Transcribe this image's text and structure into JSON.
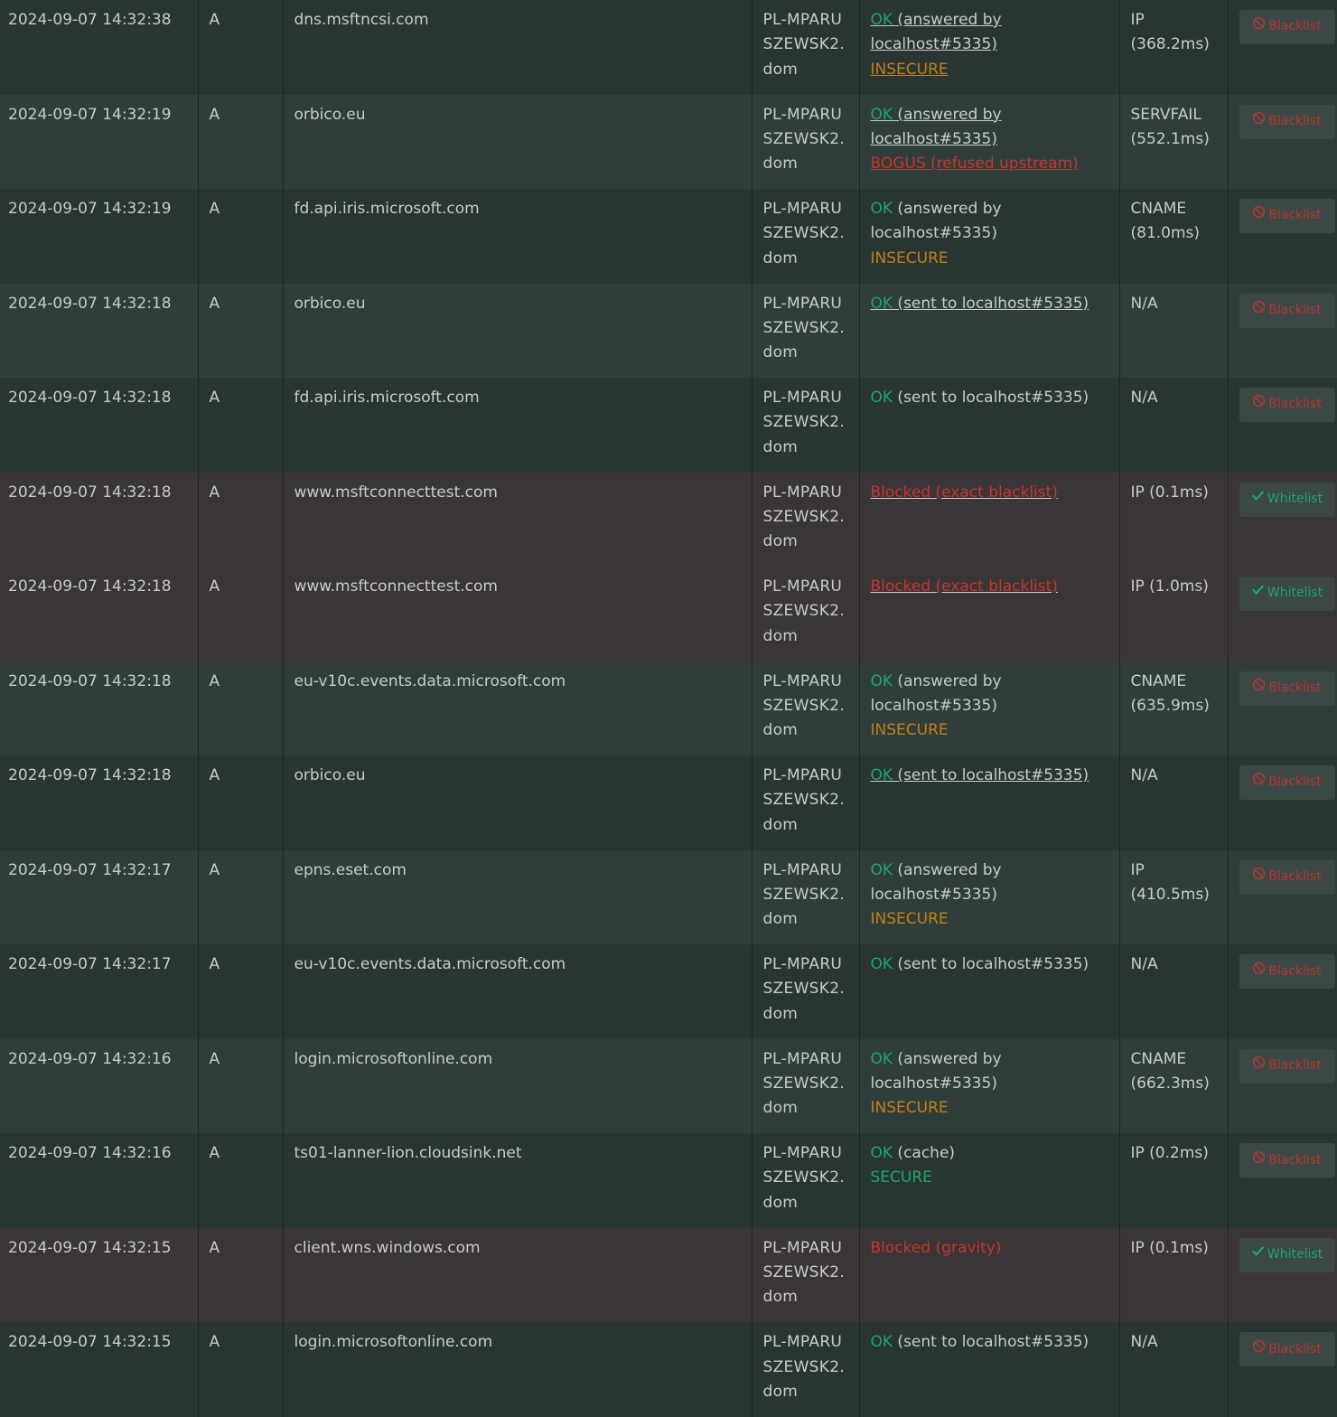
{
  "rows": [
    {
      "time": "2024-09-07 14:32:38",
      "type": "A",
      "domain": "dns.msftncsi.com",
      "client": "PL-MPARUSZEWSK2.dom",
      "status": "OK",
      "status_detail": " (answered by localhost#5335)",
      "status_class": "ok",
      "underline": true,
      "dnssec": "INSECURE",
      "dnssec_class": "insecure",
      "dnssec_underline": true,
      "reply": "IP (368.2ms)",
      "action": "Blacklist",
      "action_kind": "blacklist",
      "action_icon": "ban-icon"
    },
    {
      "time": "2024-09-07 14:32:19",
      "type": "A",
      "domain": "orbico.eu",
      "client": "PL-MPARUSZEWSK2.dom",
      "status": "OK",
      "status_detail": " (answered by localhost#5335)",
      "status_class": "ok",
      "underline": true,
      "dnssec": "BOGUS (refused upstream)",
      "dnssec_class": "red",
      "dnssec_underline": true,
      "reply": "SERVFAIL (552.1ms)",
      "action": "Blacklist",
      "action_kind": "blacklist",
      "action_icon": "ban-icon"
    },
    {
      "time": "2024-09-07 14:32:19",
      "type": "A",
      "domain": "fd.api.iris.microsoft.com",
      "client": "PL-MPARUSZEWSK2.dom",
      "status": "OK",
      "status_detail": " (answered by localhost#5335)",
      "status_class": "ok",
      "underline": false,
      "dnssec": "INSECURE",
      "dnssec_class": "insecure",
      "dnssec_underline": false,
      "reply": "CNAME (81.0ms)",
      "action": "Blacklist",
      "action_kind": "blacklist",
      "action_icon": "ban-icon"
    },
    {
      "time": "2024-09-07 14:32:18",
      "type": "A",
      "domain": "orbico.eu",
      "client": "PL-MPARUSZEWSK2.dom",
      "status": "OK",
      "status_detail": " (sent to localhost#5335)",
      "status_class": "ok",
      "underline": true,
      "dnssec": "",
      "dnssec_class": "",
      "dnssec_underline": false,
      "reply": "N/A",
      "action": "Blacklist",
      "action_kind": "blacklist",
      "action_icon": "ban-icon"
    },
    {
      "time": "2024-09-07 14:32:18",
      "type": "A",
      "domain": "fd.api.iris.microsoft.com",
      "client": "PL-MPARUSZEWSK2.dom",
      "status": "OK",
      "status_detail": " (sent to localhost#5335)",
      "status_class": "ok",
      "underline": false,
      "dnssec": "",
      "dnssec_class": "",
      "dnssec_underline": false,
      "reply": "N/A",
      "action": "Blacklist",
      "action_kind": "blacklist",
      "action_icon": "ban-icon"
    },
    {
      "time": "2024-09-07 14:32:18",
      "type": "A",
      "domain": "www.msftconnecttest.com",
      "client": "PL-MPARUSZEWSK2.dom",
      "status": "Blocked (exact blacklist)",
      "status_detail": "",
      "status_class": "red",
      "underline": true,
      "dnssec": "",
      "dnssec_class": "",
      "dnssec_underline": false,
      "reply": "IP (0.1ms)",
      "action": "Whitelist",
      "action_kind": "whitelist",
      "action_icon": "check-icon",
      "blocked": true
    },
    {
      "time": "2024-09-07 14:32:18",
      "type": "A",
      "domain": "www.msftconnecttest.com",
      "client": "PL-MPARUSZEWSK2.dom",
      "status": "Blocked (exact blacklist)",
      "status_detail": "",
      "status_class": "red",
      "underline": true,
      "dnssec": "",
      "dnssec_class": "",
      "dnssec_underline": false,
      "reply": "IP (1.0ms)",
      "action": "Whitelist",
      "action_kind": "whitelist",
      "action_icon": "check-icon",
      "blocked": true
    },
    {
      "time": "2024-09-07 14:32:18",
      "type": "A",
      "domain": "eu-v10c.events.data.microsoft.com",
      "client": "PL-MPARUSZEWSK2.dom",
      "status": "OK",
      "status_detail": " (answered by localhost#5335)",
      "status_class": "ok",
      "underline": false,
      "dnssec": "INSECURE",
      "dnssec_class": "insecure",
      "dnssec_underline": false,
      "reply": "CNAME (635.9ms)",
      "action": "Blacklist",
      "action_kind": "blacklist",
      "action_icon": "ban-icon"
    },
    {
      "time": "2024-09-07 14:32:18",
      "type": "A",
      "domain": "orbico.eu",
      "client": "PL-MPARUSZEWSK2.dom",
      "status": "OK",
      "status_detail": " (sent to localhost#5335)",
      "status_class": "ok",
      "underline": true,
      "dnssec": "",
      "dnssec_class": "",
      "dnssec_underline": false,
      "reply": "N/A",
      "action": "Blacklist",
      "action_kind": "blacklist",
      "action_icon": "ban-icon"
    },
    {
      "time": "2024-09-07 14:32:17",
      "type": "A",
      "domain": "epns.eset.com",
      "client": "PL-MPARUSZEWSK2.dom",
      "status": "OK",
      "status_detail": " (answered by localhost#5335)",
      "status_class": "ok",
      "underline": false,
      "dnssec": "INSECURE",
      "dnssec_class": "insecure",
      "dnssec_underline": false,
      "reply": "IP (410.5ms)",
      "action": "Blacklist",
      "action_kind": "blacklist",
      "action_icon": "ban-icon"
    },
    {
      "time": "2024-09-07 14:32:17",
      "type": "A",
      "domain": "eu-v10c.events.data.microsoft.com",
      "client": "PL-MPARUSZEWSK2.dom",
      "status": "OK",
      "status_detail": " (sent to localhost#5335)",
      "status_class": "ok",
      "underline": false,
      "dnssec": "",
      "dnssec_class": "",
      "dnssec_underline": false,
      "reply": "N/A",
      "action": "Blacklist",
      "action_kind": "blacklist",
      "action_icon": "ban-icon"
    },
    {
      "time": "2024-09-07 14:32:16",
      "type": "A",
      "domain": "login.microsoftonline.com",
      "client": "PL-MPARUSZEWSK2.dom",
      "status": "OK",
      "status_detail": " (answered by localhost#5335)",
      "status_class": "ok",
      "underline": false,
      "dnssec": "INSECURE",
      "dnssec_class": "insecure",
      "dnssec_underline": false,
      "reply": "CNAME (662.3ms)",
      "action": "Blacklist",
      "action_kind": "blacklist",
      "action_icon": "ban-icon"
    },
    {
      "time": "2024-09-07 14:32:16",
      "type": "A",
      "domain": "ts01-lanner-lion.cloudsink.net",
      "client": "PL-MPARUSZEWSK2.dom",
      "status": "OK",
      "status_detail": " (cache)",
      "status_class": "ok",
      "underline": false,
      "dnssec": "SECURE",
      "dnssec_class": "secure",
      "dnssec_underline": false,
      "reply": "IP (0.2ms)",
      "action": "Blacklist",
      "action_kind": "blacklist",
      "action_icon": "ban-icon"
    },
    {
      "time": "2024-09-07 14:32:15",
      "type": "A",
      "domain": "client.wns.windows.com",
      "client": "PL-MPARUSZEWSK2.dom",
      "status": "Blocked (gravity)",
      "status_detail": "",
      "status_class": "red",
      "underline": false,
      "dnssec": "",
      "dnssec_class": "",
      "dnssec_underline": false,
      "reply": "IP (0.1ms)",
      "action": "Whitelist",
      "action_kind": "whitelist",
      "action_icon": "check-icon",
      "blocked": true
    },
    {
      "time": "2024-09-07 14:32:15",
      "type": "A",
      "domain": "login.microsoftonline.com",
      "client": "PL-MPARUSZEWSK2.dom",
      "status": "OK",
      "status_detail": " (sent to localhost#5335)",
      "status_class": "ok",
      "underline": false,
      "dnssec": "",
      "dnssec_class": "",
      "dnssec_underline": false,
      "reply": "N/A",
      "action": "Blacklist",
      "action_kind": "blacklist",
      "action_icon": "ban-icon"
    }
  ]
}
